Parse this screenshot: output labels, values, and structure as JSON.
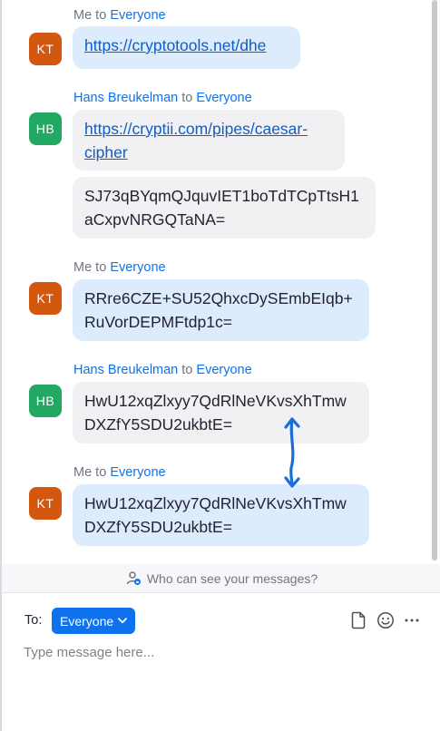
{
  "messages": [
    {
      "sender": "Me",
      "connector": " to ",
      "recipient": "Everyone",
      "avatar_initials": "KT",
      "bubbles": [
        {
          "type": "link",
          "line1": "https://cryptotools.net/dhe"
        }
      ]
    },
    {
      "sender": "Hans Breukelman",
      "connector": " to ",
      "recipient": "Everyone",
      "avatar_initials": "HB",
      "bubbles": [
        {
          "type": "link",
          "line1": "https://cryptii.com/pipes/caesar-",
          "line2": "cipher"
        },
        {
          "type": "text",
          "line1": "SJ73qBYqmQJquvIET1boTdTCpTtsH1",
          "line2": "aCxpvNRGQTaNA="
        }
      ]
    },
    {
      "sender": "Me",
      "connector": " to ",
      "recipient": "Everyone",
      "avatar_initials": "KT",
      "bubbles": [
        {
          "type": "text",
          "line1": "RRre6CZE+SU52QhxcDySEmbEIqb+",
          "line2": "RuVorDEPMFtdp1c="
        }
      ]
    },
    {
      "sender": "Hans Breukelman",
      "connector": " to ",
      "recipient": "Everyone",
      "avatar_initials": "HB",
      "bubbles": [
        {
          "type": "text",
          "line1": "HwU12xqZlxyy7QdRlNeVKvsXhTmw",
          "line2": "DXZfY5SDU2ukbtE="
        }
      ]
    },
    {
      "sender": "Me",
      "connector": " to ",
      "recipient": "Everyone",
      "avatar_initials": "KT",
      "bubbles": [
        {
          "type": "text",
          "line1": "HwU12xqZlxyy7QdRlNeVKvsXhTmw",
          "line2": "DXZfY5SDU2ukbtE="
        }
      ]
    }
  ],
  "visibility_notice": "Who can see your messages?",
  "composer": {
    "to_label": "To:",
    "recipient_selected": "Everyone",
    "placeholder": "Type message here..."
  },
  "icons": {
    "file": "file-icon",
    "emoji": "emoji-icon",
    "more": "more-icon",
    "visibility": "person-privacy-icon",
    "annotation": "double-arrow-annotation"
  },
  "colors": {
    "accent": "#0e72ed",
    "me_bubble": "#dcecfc",
    "other_bubble": "#f1f1f4",
    "avatar_kt": "#d4570f",
    "avatar_hb": "#23a863",
    "annotation_arrow": "#1a6ed8"
  }
}
